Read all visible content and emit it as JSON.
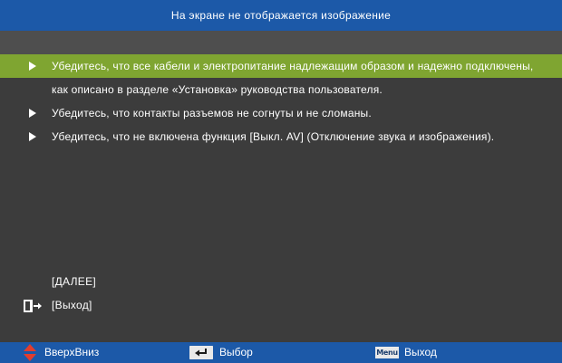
{
  "title": "На экране не отображается изображение",
  "content": {
    "rows": [
      {
        "text": "Убедитесь, что все кабели и электропитание надлежащим образом и надежно подключены,",
        "bullet": true,
        "selected": true
      },
      {
        "text": "как описано в разделе «Установка» руководства пользователя.",
        "bullet": false,
        "selected": false
      },
      {
        "text": "Убедитесь, что контакты разъемов не согнуты и не сломаны.",
        "bullet": true,
        "selected": false
      },
      {
        "text": "Убедитесь, что не включена функция [Выкл. AV] (Отключение звука и изображения).",
        "bullet": true,
        "selected": false
      }
    ]
  },
  "actions": {
    "next_label": "[ДАЛЕЕ]",
    "exit_label": "[Выход]",
    "exit_icon": "exit-door-icon"
  },
  "footer": {
    "updown_label": "ВверхВниз",
    "updown_icon": "up-down-arrows-icon",
    "select_label": "Выбор",
    "select_icon": "enter-key-icon",
    "menu_key_label": "Menu",
    "exit_label": "Выход"
  },
  "colors": {
    "title_bar": "#1c59a8",
    "background": "#3c3c3c",
    "selected_row": "#7fa531",
    "updown_icon": "#e23d2d"
  }
}
